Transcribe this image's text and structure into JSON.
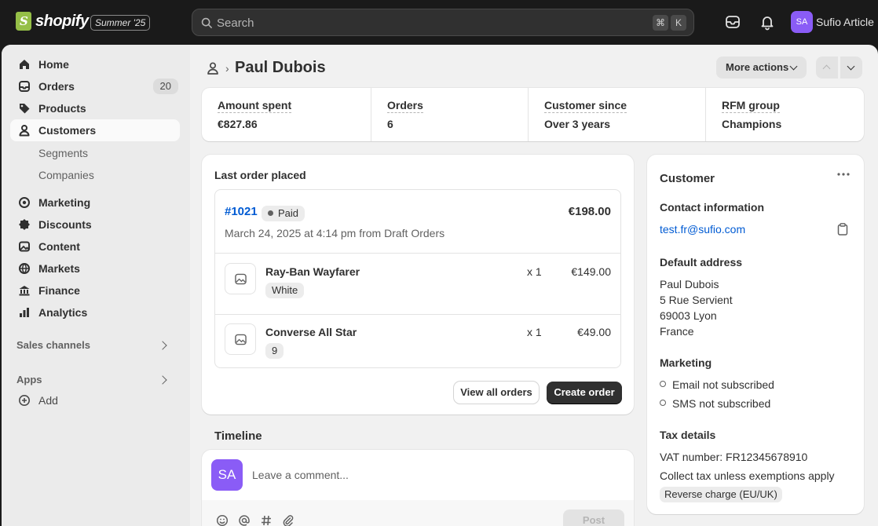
{
  "topbar": {
    "brand": "shopify",
    "edition": "Summer '25",
    "search_placeholder": "Search",
    "shortcut_key1": "⌘",
    "shortcut_key2": "K",
    "avatar_initials": "SA",
    "store_name": "Sufio Article"
  },
  "sidebar": {
    "home": "Home",
    "orders": "Orders",
    "orders_count": "20",
    "products": "Products",
    "customers": "Customers",
    "segments": "Segments",
    "companies": "Companies",
    "marketing": "Marketing",
    "discounts": "Discounts",
    "content": "Content",
    "markets": "Markets",
    "finance": "Finance",
    "analytics": "Analytics",
    "sales_channels": "Sales channels",
    "apps": "Apps",
    "add": "Add"
  },
  "header": {
    "title": "Paul Dubois",
    "more_actions": "More actions"
  },
  "stats": [
    {
      "label": "Amount spent",
      "value": "€827.86"
    },
    {
      "label": "Orders",
      "value": "6"
    },
    {
      "label": "Customer since",
      "value": "Over 3 years"
    },
    {
      "label": "RFM group",
      "value": "Champions"
    }
  ],
  "last_order": {
    "title": "Last order placed",
    "number": "#1021",
    "status": "Paid",
    "total": "€198.00",
    "date": "March 24, 2025 at 4:14 pm from Draft Orders",
    "items": [
      {
        "name": "Ray-Ban Wayfarer",
        "variant": "White",
        "qty": "x 1",
        "price": "€149.00"
      },
      {
        "name": "Converse All Star",
        "variant": "9",
        "qty": "x 1",
        "price": "€49.00"
      }
    ],
    "view_all": "View all orders",
    "create_order": "Create order"
  },
  "timeline": {
    "title": "Timeline",
    "avatar_initials": "SA",
    "placeholder": "Leave a comment...",
    "post": "Post"
  },
  "customer": {
    "title": "Customer",
    "contact_heading": "Contact information",
    "email": "test.fr@sufio.com",
    "address_heading": "Default address",
    "address_lines": [
      "Paul Dubois",
      "5 Rue Servient",
      "69003 Lyon",
      "France"
    ],
    "marketing_heading": "Marketing",
    "email_marketing": "Email not subscribed",
    "sms_marketing": "SMS not subscribed",
    "tax_heading": "Tax details",
    "vat": "VAT number: FR12345678910",
    "tax_rule": "Collect tax unless exemptions apply",
    "tax_badge": "Reverse charge (EU/UK)"
  }
}
